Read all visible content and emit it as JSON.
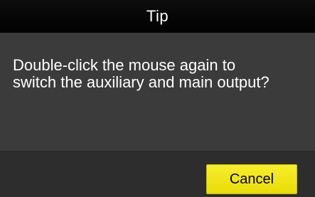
{
  "dialog": {
    "title": "Tip",
    "message": "Double-click the mouse again to\nswitch the auxiliary and main output?",
    "cancel_label": "Cancel"
  },
  "colors": {
    "title_bar": "#000000",
    "body": "#3b3b3b",
    "footer": "#2d2d2d",
    "button": "#f2e61a",
    "text": "#ffffff"
  }
}
